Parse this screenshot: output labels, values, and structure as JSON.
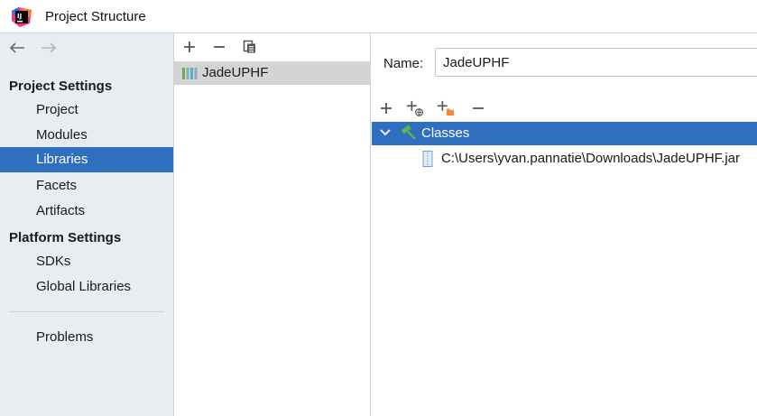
{
  "window": {
    "title": "Project Structure",
    "app_icon": "intellij-idea-icon"
  },
  "navigation": {
    "back_icon": "arrow-left-icon",
    "forward_icon": "arrow-right-icon"
  },
  "sidebar": {
    "sections": [
      {
        "header": "Project Settings",
        "items": [
          "Project",
          "Modules",
          "Libraries",
          "Facets",
          "Artifacts"
        ]
      },
      {
        "header": "Platform Settings",
        "items": [
          "SDKs",
          "Global Libraries"
        ]
      }
    ],
    "problems_label": "Problems",
    "selected_item": "Libraries"
  },
  "libraries_panel": {
    "toolbar": {
      "add_icon": "plus-icon",
      "remove_icon": "minus-icon",
      "copy_icon": "copy-icon"
    },
    "items": [
      {
        "label": "JadeUPHF",
        "icon": "library-icon",
        "selected": true
      }
    ]
  },
  "library_details": {
    "name_label": "Name:",
    "name_value": "JadeUPHF",
    "toolbar": {
      "add_icon": "plus-icon",
      "add_with_globe_icon": "add-url-icon",
      "add_with_folder_icon": "add-folder-icon",
      "remove_icon": "minus-icon"
    },
    "tree": {
      "root_label": "Classes",
      "root_expanded": true,
      "children": [
        "C:\\Users\\yvan.pannatie\\Downloads\\JadeUPHF.jar"
      ]
    }
  },
  "colors": {
    "selection_blue": "#2f6fbf",
    "sidebar_bg": "#e9edf2",
    "list_selected_gray": "#d4d4d4"
  }
}
